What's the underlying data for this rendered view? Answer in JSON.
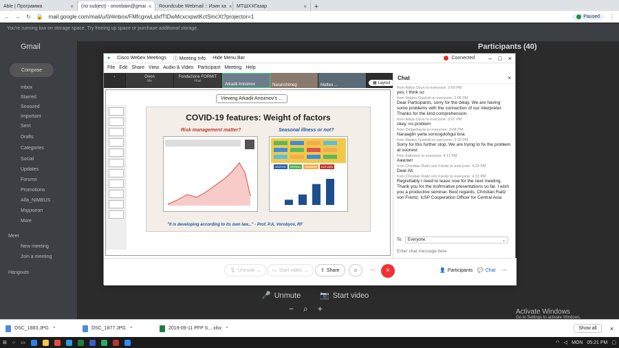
{
  "browser": {
    "tabs": [
      {
        "label": "Able | Программа",
        "active": false
      },
      {
        "label": "(no subject) - ononbain@gmai",
        "active": true
      },
      {
        "label": "Roundcube Webmail :: Изин ха",
        "active": false
      },
      {
        "label": "МТШХХГазар",
        "active": false
      }
    ],
    "url": "mail.google.com/mail/u/0/#inbox/FMfcgxwLslxfTtDwMcxcxpwtKctSmcXt?projector=1",
    "profile_status": "Paused"
  },
  "gmail": {
    "notice": "You're running low on storage space. Try freeing up space or purchase additional storage.",
    "logo": "Gmail",
    "compose": "Compose",
    "sidebar": [
      "Inbox",
      "Starred",
      "Snoozed",
      "Important",
      "Sent",
      "Drafts",
      "Categories",
      "Social",
      "Updates",
      "Forums",
      "Promotions",
      "Alfa_NIMBUS",
      "Мэдээлэл",
      "More"
    ],
    "meet_title": "Meet",
    "meet_items": [
      "New meeting",
      "Join a meeting"
    ],
    "hangouts_title": "Hangouts"
  },
  "zoom": {
    "participants_title": "Participants (40)",
    "unmute": "Unmute",
    "start_video": "Start video",
    "activate_title": "Activate Windows",
    "activate_sub": "Go to Settings to activate Windows."
  },
  "webex": {
    "title": "Cisco Webex Meetings",
    "meeting_info": "Meeting Info",
    "hide_menu": "Hide Menu Bar",
    "menu": [
      "File",
      "Edit",
      "Share",
      "View",
      "Audio & Video",
      "Participant",
      "Meeting",
      "Help"
    ],
    "status": "Connected",
    "tiles": [
      {
        "name": "Onon",
        "role": "Me"
      },
      {
        "name": "Fondazione FORMIT",
        "role": "Host"
      },
      {
        "name": "Arkadii Anisimov",
        "role": ""
      },
      {
        "name": "Naranchimeg",
        "role": ""
      },
      {
        "name": "Matteo ...",
        "role": ""
      }
    ],
    "layout_label": "Layout",
    "viewing": "Viewing Arkadii Anisimov's ...",
    "bottom_controls": {
      "unmute": "Unmute",
      "start_video": "Start video",
      "share": "Share",
      "participants": "Participants",
      "chat": "Chat"
    }
  },
  "slide": {
    "title": "COVID-19 features: Weight of factors",
    "left_subtitle": "Risk management matter?",
    "right_subtitle": "Seasonal illness or not?",
    "quote": "\"It is developing according to its own law...\" - Prof. P.A. Vorobyov, RF",
    "seasons": [
      "WINTER",
      "SPRING",
      "SUMMER",
      "AUTUMN"
    ],
    "bar_values": [
      1,
      2,
      4,
      5
    ]
  },
  "chat": {
    "title": "Chat",
    "messages": [
      {
        "from": "from Adiya Oyun to everyone:",
        "time": "2:59 PM",
        "text": "yes, I think so"
      },
      {
        "from": "from Matteo Guidotti to everyone:",
        "time": "3:05 PM",
        "text": "Dear Participants, sorry for the delay. We are having some problems with the connection of our interpreter. Thanks for the kind comprehension"
      },
      {
        "from": "from Adiya Oyun to everyone:",
        "time": "3:07 PM",
        "text": "okey, no problem"
      },
      {
        "from": "from Delgerbayar to everyone:",
        "time": "3:08 PM",
        "text": "Naraaglin yarla sonsogdohgui bna"
      },
      {
        "from": "from Matteo Guidotti to everyone:",
        "time": "3:20 PM",
        "text": "Sorry for this further stop. We are trying to fix the problem at soonest"
      },
      {
        "from": "from battumur to everyone:",
        "time": "4:11 PM",
        "text": "Ажилмт"
      },
      {
        "from": "from Christian Raitz von Frentz to everyone:",
        "time": "4:29 PM",
        "text": "Dear All,"
      },
      {
        "from": "from Christian Raitz von Frentz to everyone:",
        "time": "4:31 PM",
        "text": "Regrettably I need to leave now for the next meeting. Thank you for the inofrmative presentations so far. I wish you a productive seminar. Best regards, Christian Raitz von Frentz, IcSP Cooperation Officer for Central Asia"
      }
    ],
    "to_label": "To:",
    "to_value": "Everyone",
    "placeholder": "Enter chat message here"
  },
  "downloads": {
    "items": [
      "DSC_1883.JPG",
      "DSC_1877.JPG",
      "2019-09-11 PFP S....xlsx"
    ],
    "show_all": "Show all"
  },
  "taskbar": {
    "lang": "MON",
    "time": "05:21 PM"
  },
  "colors": {
    "end_call": "#ee3333",
    "connected_dot": "#d93025",
    "slide_subtitle_left": "#c0392b",
    "slide_subtitle_right": "#2057a7"
  }
}
